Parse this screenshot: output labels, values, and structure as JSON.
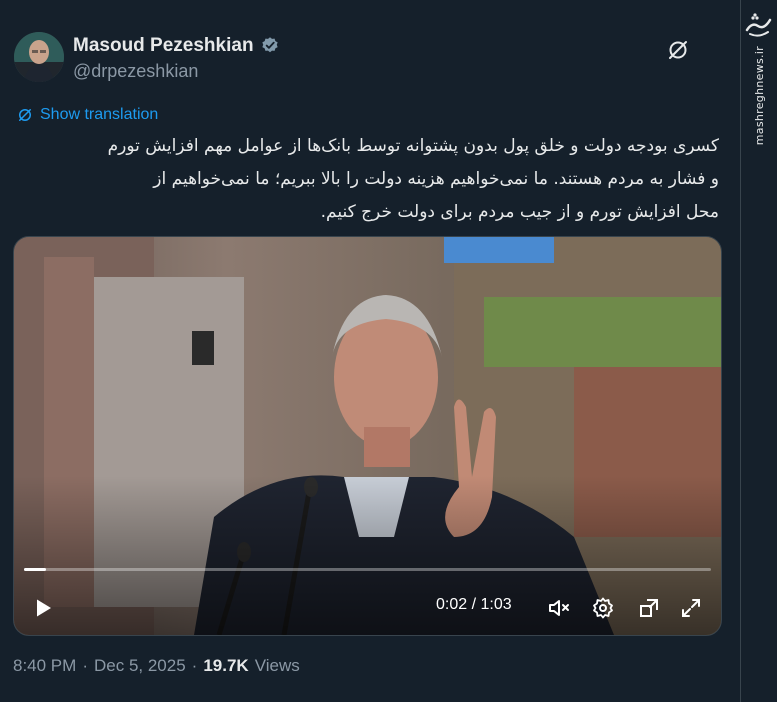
{
  "author": {
    "name": "Masoud Pezeshkian",
    "handle": "@drpezeshkian",
    "verified_icon": "verified-badge-icon"
  },
  "grok_icon": "grok-icon",
  "translation": {
    "label": "Show translation",
    "icon": "translate-icon"
  },
  "tweet": {
    "lines": [
      "کسری بودجه دولت و خلق پول بدون پشتوانه توسط بانک‌ها از عوامل مهم افزایش تورم",
      "و فشار به مردم هستند. ما نمی‌خواهیم هزینه دولت را بالا ببریم؛ ما نمی‌خواهیم از",
      "محل افزایش تورم و از جیب مردم برای دولت خرج کنیم."
    ]
  },
  "video": {
    "current_time": "0:02",
    "separator": "/",
    "duration": "1:03",
    "progress": 0.032,
    "controls": [
      "play-icon",
      "mute-icon",
      "settings-icon",
      "pip-icon",
      "fullscreen-icon"
    ]
  },
  "meta": {
    "time": "8:40 PM",
    "dot1": "·",
    "date": "Dec 5, 2025",
    "dot2": "·",
    "views_count": "19.7K",
    "views_label": "Views"
  },
  "watermark": {
    "text": "mashreghnews.ir",
    "logo": "mashregh-logo"
  },
  "colors": {
    "background": "#15202b",
    "text": "#e7e9ea",
    "secondary": "#8b98a5",
    "accent": "#1d9bf0",
    "border": "#38444d"
  }
}
